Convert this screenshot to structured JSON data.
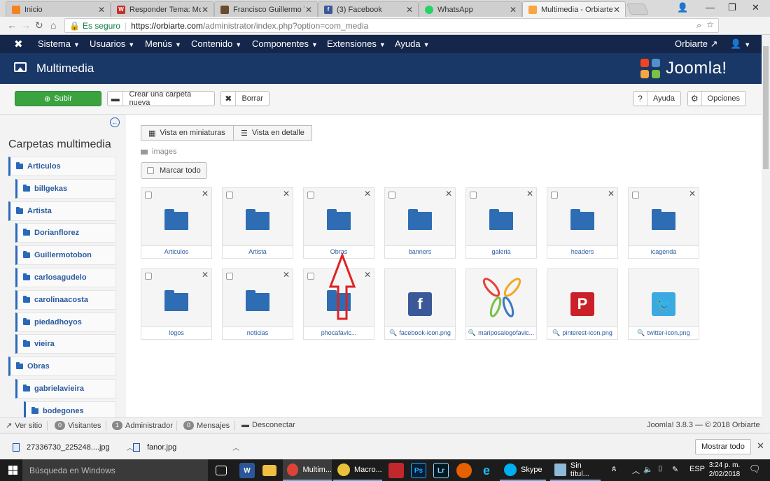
{
  "browser": {
    "tabs": [
      {
        "title": "Inicio",
        "favicon_color": "#f58220"
      },
      {
        "title": "Responder Tema: Modul",
        "favicon_color": "#c4302b"
      },
      {
        "title": "Francisco Guillermo Tob",
        "favicon_color": "#6b4a2e"
      },
      {
        "title": "(3) Facebook",
        "favicon_color": "#3b5998"
      },
      {
        "title": "WhatsApp",
        "favicon_color": "#25d366"
      },
      {
        "title": "Multimedia - Orbiarte - ",
        "favicon_color": "#f9a541"
      }
    ],
    "active_tab": 5,
    "secure_label": "Es seguro",
    "url_host": "https://orbiarte.com",
    "url_path": "/administrator/index.php?option=com_media"
  },
  "nav": {
    "menu": [
      "Sistema",
      "Usuarios",
      "Menús",
      "Contenido",
      "Componentes",
      "Extensiones",
      "Ayuda"
    ],
    "site_link": "Orbiarte"
  },
  "header": {
    "title": "Multimedia",
    "brand": "Joomla!"
  },
  "toolbar": {
    "upload": "Subir",
    "new_folder": "Crear una carpeta nueva",
    "delete": "Borrar",
    "help": "Ayuda",
    "options": "Opciones"
  },
  "sidebar": {
    "title": "Carpetas multimedia",
    "folders": [
      {
        "label": "Articulos",
        "depth": 0
      },
      {
        "label": "billgekas",
        "depth": 1
      },
      {
        "label": "Artista",
        "depth": 0
      },
      {
        "label": "Dorianflorez",
        "depth": 1
      },
      {
        "label": "Guillermotobon",
        "depth": 1
      },
      {
        "label": "carlosagudelo",
        "depth": 1
      },
      {
        "label": "carolinaacosta",
        "depth": 1
      },
      {
        "label": "piedadhoyos",
        "depth": 1
      },
      {
        "label": "vieira",
        "depth": 1
      },
      {
        "label": "Obras",
        "depth": 0
      },
      {
        "label": "gabrielavieira",
        "depth": 1
      },
      {
        "label": "bodegones",
        "depth": 2
      }
    ]
  },
  "main": {
    "view_thumbs": "Vista en miniaturas",
    "view_detail": "Vista en detalle",
    "breadcrumb": "images",
    "mark_all": "Marcar todo",
    "folders": [
      "Articulos",
      "Artista",
      "Obras",
      "banners",
      "galeria",
      "headers",
      "icagenda",
      "logos",
      "noticias",
      "phocafavic..."
    ],
    "images": [
      {
        "name": "facebook-icon.png",
        "icon": "facebook-icon",
        "color": "#3b5998"
      },
      {
        "name": "mariposalogofavic...",
        "icon": "butterfly-logo-icon",
        "color": "#f5a623"
      },
      {
        "name": "pinterest-icon.png",
        "icon": "pinterest-icon",
        "color": "#cb2027"
      },
      {
        "name": "twitter-icon.png",
        "icon": "twitter-icon",
        "color": "#3aaae1"
      }
    ]
  },
  "status": {
    "view_site": "Ver sitio",
    "visitors_count": "0",
    "visitors_label": "Visitantes",
    "admins_count": "1",
    "admins_label": "Administrador",
    "messages_count": "0",
    "messages_label": "Mensajes",
    "logout": "Desconectar",
    "version": "Joomla! 3.8.3 — © 2018 Orbiarte"
  },
  "downloads": {
    "items": [
      "27336730_225248....jpg",
      "fanor.jpg"
    ],
    "show_all": "Mostrar todo"
  },
  "taskbar": {
    "search_placeholder": "Búsqueda en Windows",
    "apps": [
      "Multim...",
      "Macro...",
      "Skype",
      "Sin títul..."
    ],
    "lang": "ESP",
    "time": "3:24 p. m.",
    "date": "2/02/2018"
  }
}
